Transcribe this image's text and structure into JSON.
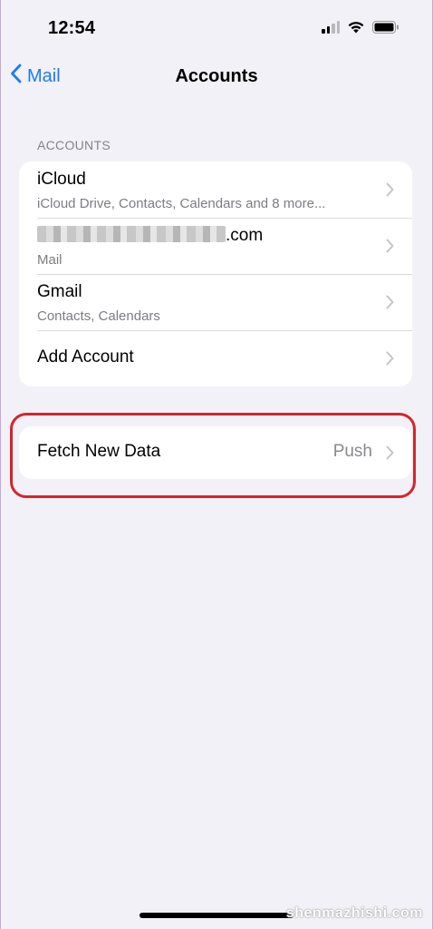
{
  "status_bar": {
    "time": "12:54"
  },
  "nav": {
    "back_label": "Mail",
    "title": "Accounts"
  },
  "accounts_section": {
    "header": "ACCOUNTS",
    "rows": [
      {
        "title": "iCloud",
        "subtitle": "iCloud Drive, Contacts, Calendars and 8 more..."
      },
      {
        "title_suffix": ".com",
        "subtitle": "Mail"
      },
      {
        "title": "Gmail",
        "subtitle": "Contacts, Calendars"
      },
      {
        "title": "Add Account"
      }
    ]
  },
  "fetch_section": {
    "title": "Fetch New Data",
    "value": "Push"
  },
  "watermark": "shenmazhishi.com",
  "colors": {
    "accent": "#1a7cf5",
    "background": "#f2f1f7",
    "highlight": "#d8232b"
  }
}
